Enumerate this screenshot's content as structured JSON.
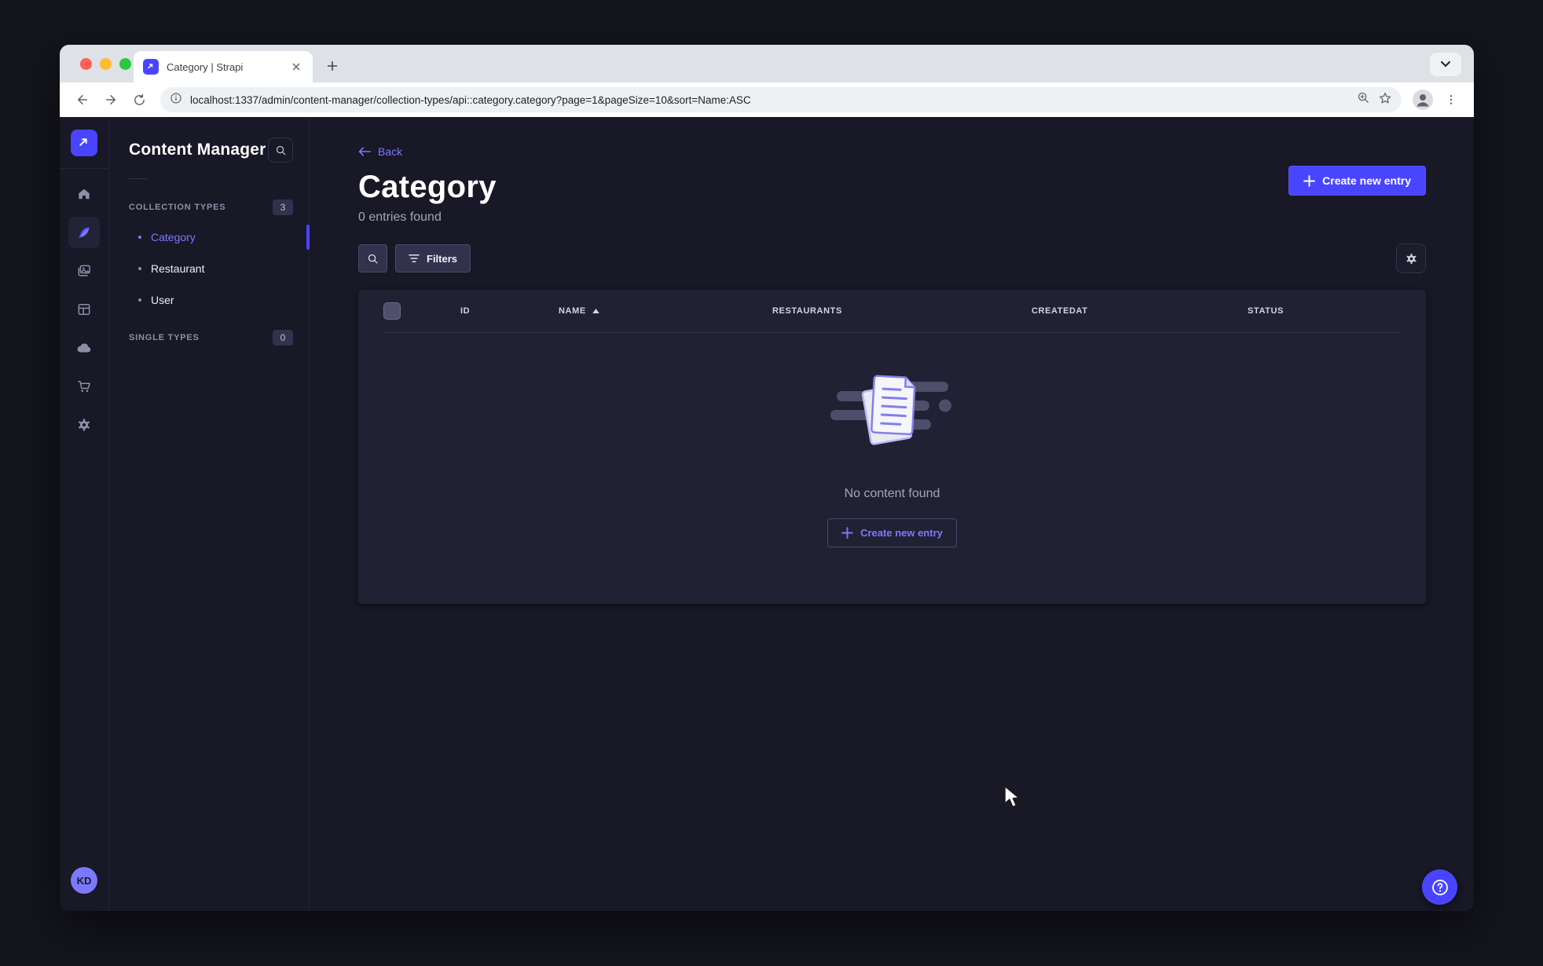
{
  "window": {
    "tab_title": "Category | Strapi",
    "url": "localhost:1337/admin/content-manager/collection-types/api::category.category?page=1&pageSize=10&sort=Name:ASC"
  },
  "colors": {
    "accent": "#4945ff",
    "accent_light": "#7b79ff",
    "app_bg": "#181826",
    "card_bg": "#212134",
    "border": "#32324d"
  },
  "rail": {
    "avatar_initials": "KD",
    "icons": [
      "strapi-logo",
      "home",
      "content-manager-feather",
      "media-library",
      "content-type-builder",
      "cloud",
      "marketplace-cart",
      "settings-gear"
    ]
  },
  "sidebar": {
    "title": "Content Manager",
    "sections": [
      {
        "label": "COLLECTION TYPES",
        "badge": "3",
        "items": [
          {
            "label": "Category",
            "active": true
          },
          {
            "label": "Restaurant",
            "active": false
          },
          {
            "label": "User",
            "active": false
          }
        ]
      },
      {
        "label": "SINGLE TYPES",
        "badge": "0"
      }
    ]
  },
  "main": {
    "back_label": "Back",
    "title": "Category",
    "subtitle": "0 entries found",
    "create_button_label": "Create new entry",
    "filters_label": "Filters",
    "table": {
      "columns": [
        "ID",
        "NAME",
        "RESTAURANTS",
        "CREATEDAT",
        "STATUS"
      ],
      "sort_column": "NAME",
      "sort_direction": "ASC",
      "rows": [],
      "empty_message": "No content found",
      "empty_create_label": "Create new entry"
    }
  }
}
